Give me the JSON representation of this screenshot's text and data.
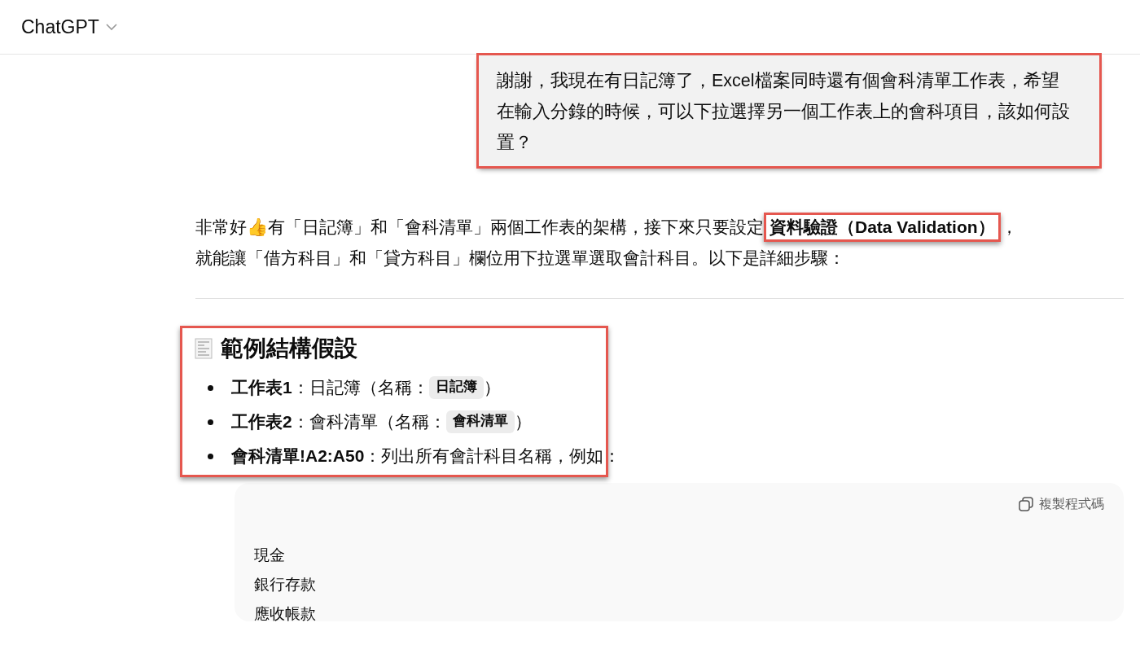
{
  "header": {
    "title": "ChatGPT"
  },
  "user_message": {
    "text": "謝謝，我現在有日記簿了，Excel檔案同時還有個會科清單工作表，希望在輸入分錄的時候，可以下拉選擇另一個工作表上的會科項目，該如何設置？",
    "highlighted": true
  },
  "reply": {
    "intro": "非常好👍有「日記簿」和「會科清單」兩個工作表的架構，接下來只要設定**資料驗證（Data Validation）**，就能讓「借方科目」和「貸方科目」欄位用下拉選單選取會計科目。以下是詳細步驟：",
    "intro_highlighted": true,
    "section": {
      "title": "範例結構假設",
      "highlighted": true,
      "items": [
        {
          "label": "工作表1",
          "text": "：日記簿（名稱：",
          "code": "日記簿",
          "after": "）"
        },
        {
          "label": "工作表2",
          "text": "：會科清單（名稱：",
          "code": "會科清單",
          "after": "）"
        },
        {
          "label": "會科清單!A2:A50",
          "text": "：列出所有會計科目名稱，例如："
        }
      ]
    },
    "code_block": {
      "copy_label": "複製程式碼",
      "lines": [
        "現金",
        "銀行存款",
        "應收帳款"
      ]
    }
  }
}
